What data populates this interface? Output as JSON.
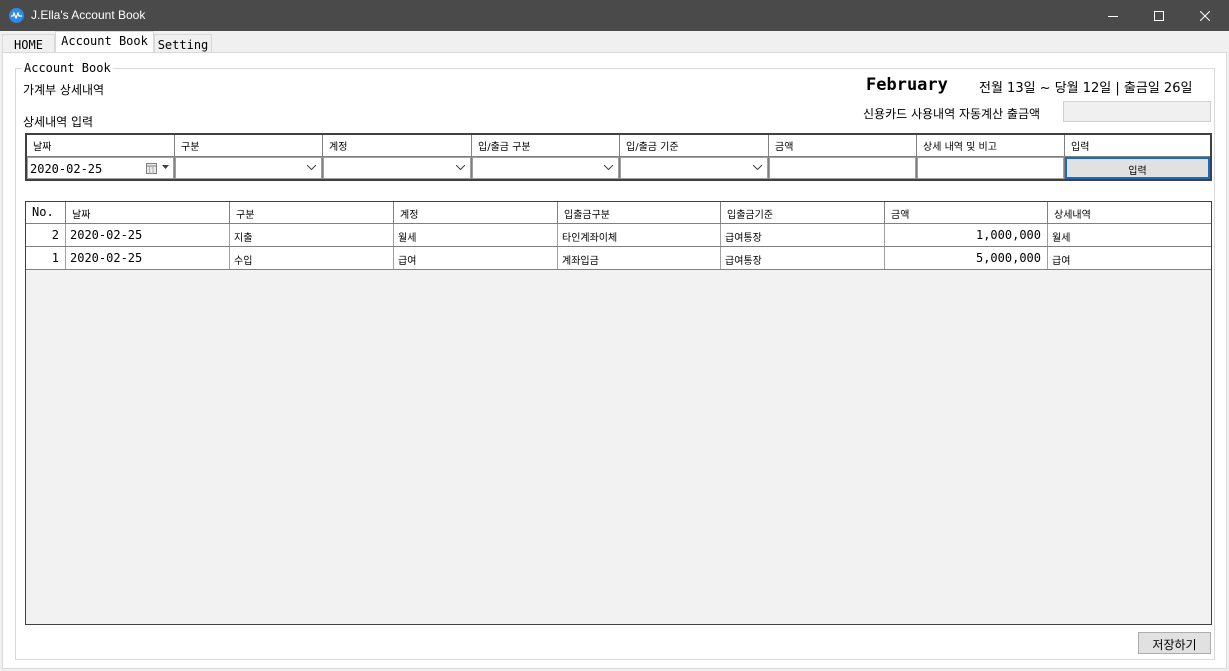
{
  "window": {
    "title": "J.Ella's Account Book",
    "colors": {
      "titlebar": "#4a4a4a",
      "accent": "#2b8be6",
      "selected_button_border": "#1c68c7"
    }
  },
  "tabs": [
    {
      "label": "HOME"
    },
    {
      "label": "Account Book",
      "active": true
    },
    {
      "label": "Setting"
    }
  ],
  "group": {
    "legend": "Account Book"
  },
  "header": {
    "subtitle": "가계부 상세내역",
    "entry_title": "상세내역 입력",
    "month": "February",
    "period": "전월 13일 ~ 당월 12일 | 출금일 26일",
    "cc_label": "신용카드 사용내역 자동계산 출금액",
    "cc_value": ""
  },
  "entry": {
    "headers": [
      "날짜",
      "구분",
      "계정",
      "입/출금 구분",
      "입/출금 기준",
      "금액",
      "상세 내역 및 비고",
      "입력"
    ],
    "date_value": "2020-02-25",
    "combo_values": [
      "",
      "",
      "",
      ""
    ],
    "amount_value": "",
    "detail_value": "",
    "submit_label": "입력"
  },
  "list": {
    "headers": [
      "No.",
      "날짜",
      "구분",
      "계정",
      "입출금구분",
      "입출금기준",
      "금액",
      "상세내역"
    ],
    "rows": [
      {
        "no": "2",
        "date": "2020-02-25",
        "type": "지출",
        "account": "월세",
        "io_type": "타인계좌이체",
        "io_basis": "급여통장",
        "amount": "1,000,000",
        "detail": "월세"
      },
      {
        "no": "1",
        "date": "2020-02-25",
        "type": "수입",
        "account": "급여",
        "io_type": "계좌입금",
        "io_basis": "급여통장",
        "amount": "5,000,000",
        "detail": "급여"
      }
    ]
  },
  "footer": {
    "save_label": "저장하기"
  }
}
